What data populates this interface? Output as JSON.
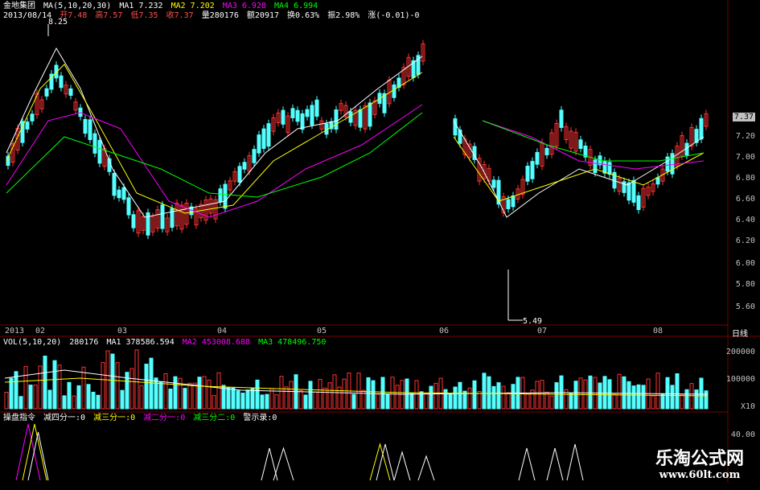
{
  "header": {
    "stock_name": "金地集团",
    "ma_settings": "MA(5,10,20,30)",
    "ma1": "MA1 7.232",
    "ma2": "MA2 7.202",
    "ma3": "MA3 6.928",
    "ma4": "MA4 6.994",
    "date": "2013/08/14",
    "open": "开7.48",
    "high": "高7.57",
    "low": "低7.35",
    "close": "收7.37",
    "volume": "量280176",
    "amount": "额20917",
    "turnover": "换0.63%",
    "amplitude": "振2.98%",
    "change": "涨(-0.01)-0"
  },
  "price_axis": [
    "7.37",
    "7.20",
    "7.00",
    "6.80",
    "6.60",
    "6.40",
    "6.20",
    "6.00",
    "5.80",
    "5.60"
  ],
  "price_markers": {
    "high_label": "8.25",
    "low_label": "5.49"
  },
  "date_axis": [
    "2013",
    "02",
    "03",
    "04",
    "05",
    "06",
    "07",
    "08"
  ],
  "period_label": "日线",
  "volume_header": {
    "settings": "VOL(5,10,20)",
    "vol": "280176",
    "ma1": "MA1 378586.594",
    "ma2": "MA2 453008.688",
    "ma3": "MA3 478496.750"
  },
  "volume_axis": [
    "200000",
    "100000",
    "X10"
  ],
  "indicator_header": {
    "name": "操盘指令",
    "l1": "减四分一:0",
    "l2": "减三分一:0",
    "l3": "减二分一:0",
    "l4": "减三分二:0",
    "l5": "警示录:0"
  },
  "indicator_axis": [
    "40.00"
  ],
  "watermark": {
    "name": "乐淘公式网",
    "url": "www.60lt.com"
  },
  "colors": {
    "up": "#ff3232",
    "down": "#54ffff",
    "ma1": "#ffffff",
    "ma2": "#ffff00",
    "ma3": "#ff00ff",
    "ma4": "#00ff00",
    "grid": "#7a0000"
  }
}
